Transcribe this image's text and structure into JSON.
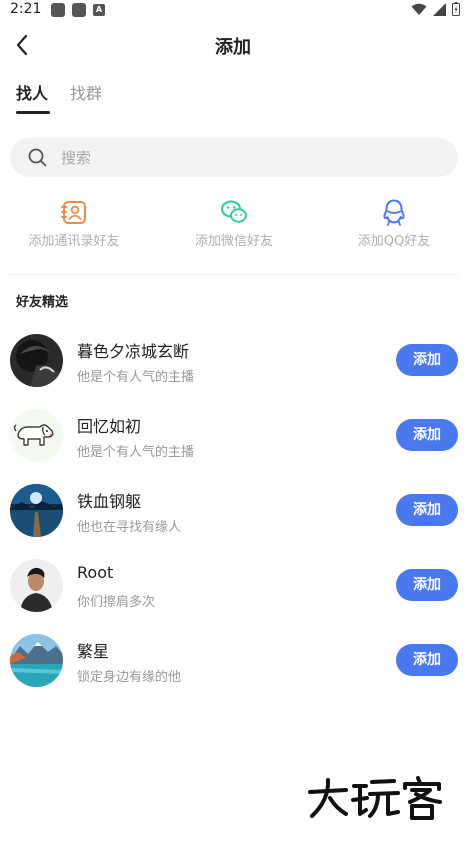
{
  "status_bar": {
    "time": "2:21"
  },
  "nav": {
    "title": "添加"
  },
  "tabs": [
    {
      "label": "找人",
      "active": true
    },
    {
      "label": "找群",
      "active": false
    }
  ],
  "search": {
    "placeholder": "搜索"
  },
  "quick_actions": [
    {
      "label": "添加通讯录好友",
      "icon": "contacts-icon",
      "color": "#f28a4b"
    },
    {
      "label": "添加微信好友",
      "icon": "wechat-icon",
      "color": "#2ccf9a"
    },
    {
      "label": "添加QQ好友",
      "icon": "qq-icon",
      "color": "#4a78ee"
    }
  ],
  "section": {
    "title": "好友精选"
  },
  "friends": [
    {
      "name": "暮色夕凉城玄断",
      "subtitle": "他是个有人气的主播",
      "button": "添加"
    },
    {
      "name": "回忆如初",
      "subtitle": "他是个有人气的主播",
      "button": "添加"
    },
    {
      "name": "铁血钢躯",
      "subtitle": "他也在寻找有缘人",
      "button": "添加"
    },
    {
      "name": "Root",
      "subtitle": "你们擦肩多次",
      "button": "添加"
    },
    {
      "name": "繁星",
      "subtitle": "锁定身边有缘的他",
      "button": "添加"
    }
  ],
  "watermark": {
    "text": "大玩客"
  },
  "colors": {
    "accent": "#4a78ee",
    "search_bg": "#f2f2f2"
  }
}
